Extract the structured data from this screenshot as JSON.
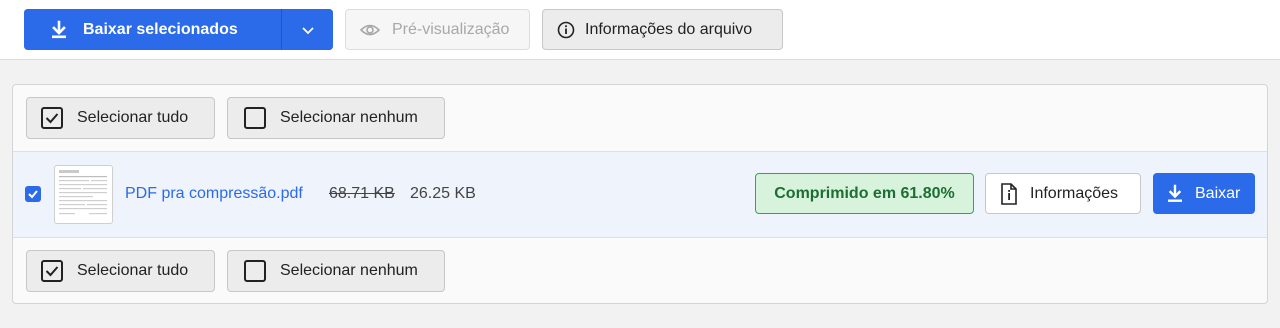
{
  "toolbar": {
    "download_selected_label": "Baixar selecionados",
    "preview_label": "Pré-visualização",
    "file_info_label": "Informações do arquivo"
  },
  "selection": {
    "select_all_label": "Selecionar tudo",
    "select_none_label": "Selecionar nenhum"
  },
  "file": {
    "checked": true,
    "name": "PDF pra compressão.pdf",
    "original_size": "68.71 KB",
    "compressed_size": "26.25 KB",
    "status": "Comprimido em 61.80%",
    "info_label": "Informações",
    "download_label": "Baixar"
  },
  "colors": {
    "accent": "#2b6ae8",
    "success_bg": "#d7f3dc",
    "success_text": "#1e6e33",
    "success_border": "#3aa154"
  }
}
